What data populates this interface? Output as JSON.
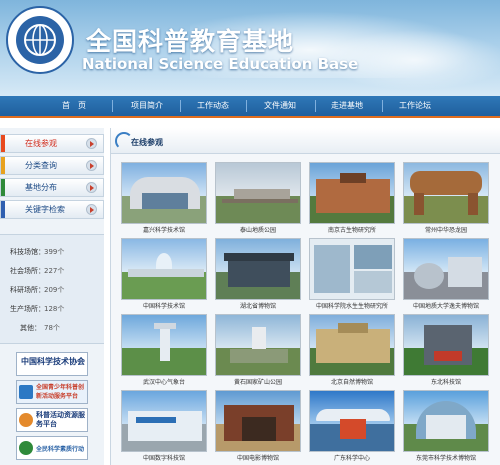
{
  "header": {
    "title_cn": "全国科普教育基地",
    "title_en": "National Science Education Base"
  },
  "nav": {
    "items": [
      {
        "label": "首　页"
      },
      {
        "label": "项目简介"
      },
      {
        "label": "工作动态"
      },
      {
        "label": "文件通知"
      },
      {
        "label": "走进基地"
      },
      {
        "label": "工作论坛"
      }
    ]
  },
  "sidebar": {
    "menu": [
      {
        "label": "在线参观",
        "color": "#e84a1f"
      },
      {
        "label": "分类查询",
        "color": "#e8a21f"
      },
      {
        "label": "基地分布",
        "color": "#2f8a3a"
      },
      {
        "label": "关键字检索",
        "color": "#2f5fb0"
      }
    ],
    "stats": [
      {
        "label": "科技场馆：",
        "value": "399个"
      },
      {
        "label": "社会场所：",
        "value": "227个"
      },
      {
        "label": "科研场所：",
        "value": "209个"
      },
      {
        "label": "生产场所：",
        "value": "128个"
      },
      {
        "label": "其他：",
        "value": "78个"
      }
    ],
    "partners": [
      {
        "label": "中国科学技术协会"
      },
      {
        "label": "全国青少年科普创新活动服务平台"
      },
      {
        "label": "科普活动资源服务平台"
      },
      {
        "label": "全民科学素质行动"
      }
    ]
  },
  "main": {
    "heading": "在线参观",
    "items": [
      {
        "caption": "嘉兴科学技术馆"
      },
      {
        "caption": "泰山地质公园"
      },
      {
        "caption": "南京古生物研究所"
      },
      {
        "caption": "常州中华恐龙园"
      },
      {
        "caption": "中国科学技术馆"
      },
      {
        "caption": "湖北省博物馆"
      },
      {
        "caption": "中国科学院水生生物研究所"
      },
      {
        "caption": "中国地质大学逸夫博物馆"
      },
      {
        "caption": "武汉中心气象台"
      },
      {
        "caption": "黄石国家矿山公园"
      },
      {
        "caption": "北京自然博物馆"
      },
      {
        "caption": "东北科技馆"
      },
      {
        "caption": "中国数字科技馆"
      },
      {
        "caption": "中国电影博物馆"
      },
      {
        "caption": "广东科学中心"
      },
      {
        "caption": "东莞市科学技术博物馆"
      }
    ]
  },
  "colors": {
    "nav_bg": "#1f5f9d",
    "nav_border": "#e06d1e",
    "accent_red": "#d12a1a"
  }
}
